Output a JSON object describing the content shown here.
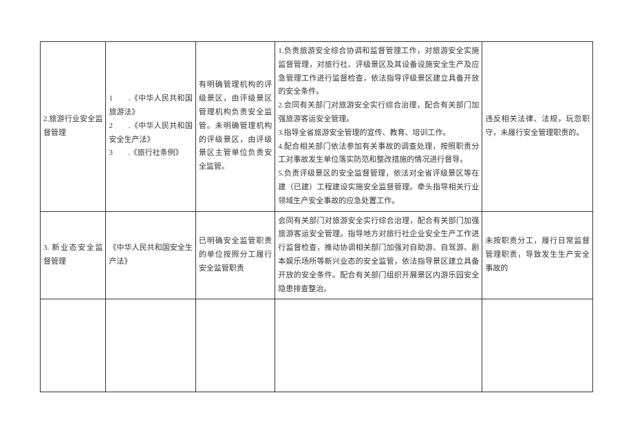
{
  "rows": [
    {
      "c1": "2.旅游行业安全监督管理",
      "c2": "1　　.《中华人民共和国旅游法》\n2　　.《中华人民共和国安全生产法》\n3　　.《旅行社条例》",
      "c3": "有明确管理机构的评级景区，由评级景区管理机构负责安全监管。未明确管理机构的评级景区，由评级景区主管单位负责安全监管。",
      "c4": "1.负责旅游安全综合协调和监督管理工作，对旅游安全实施监督管理，对旅行社、评级景区及其设备设施安全生产及应急管理工作进行监督检查，依法指导评级景区建立具备开放的安全条件。\n2.会同有关部门对旅游安全实行综合治理，配合有关部门加强旅游客运安全管理。\n3.指导全省旅游安全管理的宣传、教育、培训工作。\n4.配合相关部门依法参加有关事故的调查处理，按照职责分工对事故发生单位落实防范和整改措施的情况进行督导。\n5.负责评级景区的安全监督管理，依法对全省评级景区等在建（已建）工程建设实施安全监督管理。牵头指导相关行业领域生产安全事故的应急处置工作。",
      "c5": "违反相关法律、法规，玩忽职守，未履行安全管理职责的。"
    },
    {
      "c1": "3. 新业态安全监督管理",
      "c2": "《中华人民共和国安全生产法》",
      "c3": "已明确安全监管职责的单位按照分工履行安全监管职责",
      "c4": "会同有关部门对旅游安全实行综合治理，配合有关部门加强旅游客运安全管理。指导地方对旅行社企业安全生产工作进行监督检查，推动协调相关部门加强对自助游、自驾游、剧本娱乐场所等新兴业态的安全监管，依法指导景区建立具备开放的安全条件。配合有关部门组织开展景区内游乐园安全隐患排查整治。",
      "c5": "未按职责分工，履行日常监督管理职责，导致发生生产安全事故的"
    }
  ],
  "emptyRow": {
    "c1": "",
    "c2": "",
    "c3": "",
    "c4": "",
    "c5": ""
  }
}
